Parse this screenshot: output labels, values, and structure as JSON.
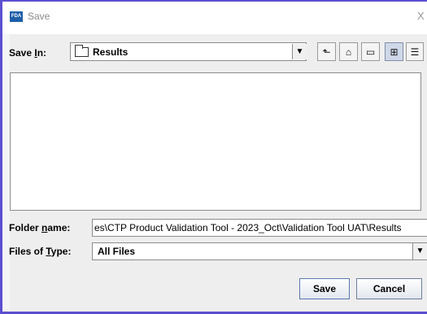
{
  "window": {
    "title": "Save",
    "logo_text": "FDA",
    "close_glyph": "X"
  },
  "save_in": {
    "label_prefix": "Save ",
    "label_mnemonic": "I",
    "label_suffix": "n:",
    "value": "Results",
    "arrow_glyph": "▼"
  },
  "toolbar": {
    "buttons": [
      {
        "name": "up-one-level-icon",
        "glyph": "⬑"
      },
      {
        "name": "home-icon",
        "glyph": "⌂"
      },
      {
        "name": "new-folder-icon",
        "glyph": "▭"
      },
      {
        "name": "list-view-icon",
        "glyph": "⊞"
      },
      {
        "name": "details-view-icon",
        "glyph": "☰"
      }
    ]
  },
  "folder_name": {
    "label_prefix": "Folder ",
    "label_mnemonic": "n",
    "label_suffix": "ame:",
    "value": "es\\CTP Product Validation Tool - 2023_Oct\\Validation Tool UAT\\Results"
  },
  "files_of_type": {
    "label_prefix": "Files of ",
    "label_mnemonic": "T",
    "label_suffix": "ype:",
    "value": "All Files",
    "arrow_glyph": "▼"
  },
  "buttons": {
    "save": "Save",
    "cancel": "Cancel"
  },
  "colors": {
    "window_border": "#5b4fd1",
    "dialog_background": "#eeeeee",
    "logo_blue": "#1f5fa8"
  }
}
